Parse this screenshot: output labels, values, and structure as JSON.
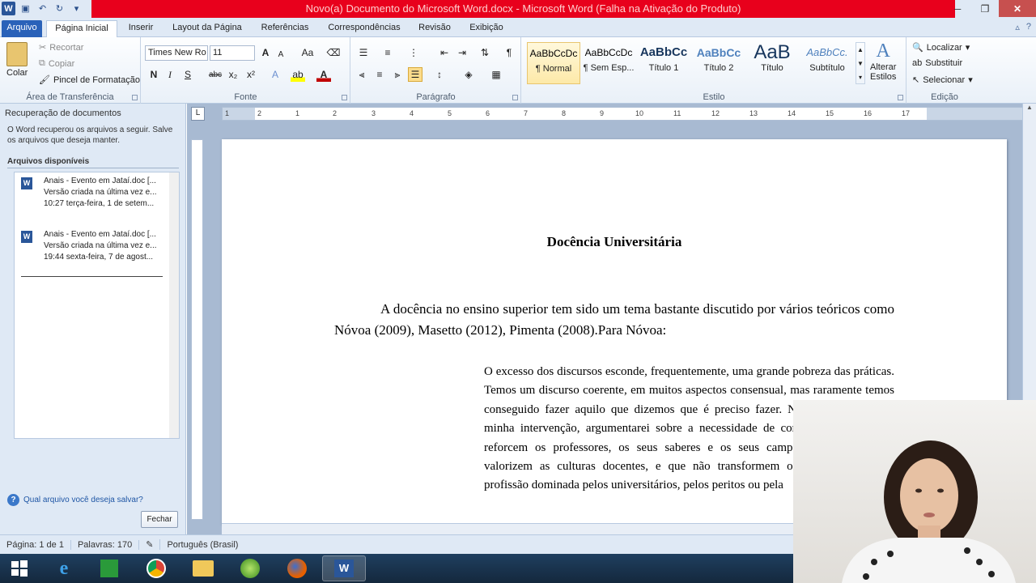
{
  "window": {
    "title": "Novo(a) Documento do Microsoft Word.docx - Microsoft Word (Falha na Ativação do Produto)",
    "app_icon": "W",
    "controls": [
      "minimize-icon",
      "maximize-icon",
      "close-icon"
    ]
  },
  "ribbon_tabs": {
    "file": "Arquivo",
    "items": [
      "Página Inicial",
      "Inserir",
      "Layout da Página",
      "Referências",
      "Correspondências",
      "Revisão",
      "Exibição"
    ],
    "active": "Página Inicial"
  },
  "clipboard": {
    "paste": "Colar",
    "cut": "Recortar",
    "copy": "Copiar",
    "format_painter": "Pincel de Formatação",
    "label": "Área de Transferência"
  },
  "font": {
    "name": "Times New Ro",
    "size": "11",
    "label": "Fonte",
    "bold": "N",
    "italic": "I",
    "underline": "S",
    "strike": "abc",
    "sub": "x₂",
    "sup": "x²",
    "grow": "A",
    "shrink": "A",
    "case": "Aa",
    "effects": "A",
    "highlight": "ab",
    "color": "A"
  },
  "paragraph": {
    "label": "Parágrafo"
  },
  "styles": {
    "label": "Estilo",
    "items": [
      {
        "sample": "AaBbCcDc",
        "name": "¶ Normal"
      },
      {
        "sample": "AaBbCcDc",
        "name": "¶ Sem Esp..."
      },
      {
        "sample": "AaBbCc",
        "name": "Título 1"
      },
      {
        "sample": "AaBbCc",
        "name": "Título 2"
      },
      {
        "sample": "AaB",
        "name": "Título"
      },
      {
        "sample": "AaBbCc.",
        "name": "Subtítulo"
      }
    ],
    "change_line1": "Alterar",
    "change_line2": "Estilos"
  },
  "editing": {
    "find": "Localizar",
    "replace": "Substituir",
    "select": "Selecionar",
    "label": "Edição"
  },
  "recovery": {
    "title": "Recuperação de documentos",
    "description": "O Word recuperou os arquivos a seguir. Salve os arquivos que deseja manter.",
    "available": "Arquivos disponíveis",
    "files": [
      {
        "name": "Anais - Evento em Jataí.doc  [...",
        "version": "Versão criada na última vez e...",
        "time": "10:27 terça-feira, 1 de setem..."
      },
      {
        "name": "Anais - Evento em Jataí.doc  [...",
        "version": "Versão criada na última vez e...",
        "time": "19:44 sexta-feira, 7 de agost..."
      }
    ],
    "question": "Qual arquivo você deseja salvar?",
    "close": "Fechar"
  },
  "ruler": {
    "numbers": [
      "1",
      "2",
      "1",
      "2",
      "3",
      "4",
      "5",
      "6",
      "7",
      "8",
      "9",
      "10",
      "11",
      "12",
      "13",
      "14",
      "15",
      "16",
      "17"
    ]
  },
  "document": {
    "title": "Docência Universitária",
    "paragraph": "A docência no ensino superior tem sido um tema bastante discutido por vários teóricos como Nóvoa (2009), Masetto (2012), Pimenta (2008).Para Nóvoa:",
    "quote": "O excesso dos discursos esconde, frequentemente, uma grande pobreza das práticas. Temos um discurso coerente, em muitos aspectos consensual, mas raramente temos conseguido fazer aquilo que dizemos que é preciso fazer. Na segunda parte da minha intervenção, argumentarei sobre a necessidade de construir políticas que reforcem os professores, os seus saberes e os seus campos de atuação, que valorizem as culturas docentes, e que não transformem os professores numa profissão dominada pelos universitários, pelos peritos ou pela"
  },
  "status": {
    "page": "Página: 1 de 1",
    "words": "Palavras: 170",
    "language": "Português (Brasil)"
  },
  "taskbar": {
    "items": [
      "start-icon",
      "internet-explorer-icon",
      "store-icon",
      "chrome-icon",
      "file-explorer-icon",
      "media-icon",
      "firefox-icon",
      "word-icon"
    ]
  },
  "colors": {
    "title_bar_alert": "#e8001c",
    "file_tab": "#2a62b9",
    "chrome": "#dfe9f5",
    "doc_background": "#a8bad2"
  }
}
